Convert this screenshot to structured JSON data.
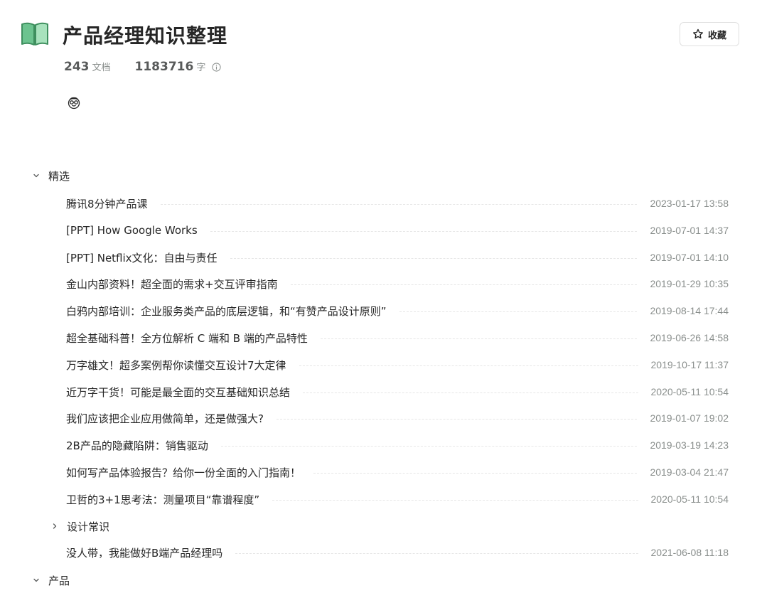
{
  "header": {
    "title": "产品经理知识整理",
    "favorite_label": "收藏",
    "doc_count": "243",
    "doc_unit": "文档",
    "word_count": "1183716",
    "word_unit": "字",
    "icons": {
      "book": "book-icon",
      "favorite": "star-icon",
      "info": "info-icon",
      "avatar": "nerd-face-emoji"
    }
  },
  "groups": [
    {
      "label": "精选",
      "expanded": true,
      "items": [
        {
          "title": "腾讯8分钟产品课",
          "time": "2023-01-17 13:58"
        },
        {
          "title": "[PPT] How Google Works",
          "time": "2019-07-01 14:37"
        },
        {
          "title": "[PPT] Netflix文化：自由与责任",
          "time": "2019-07-01 14:10"
        },
        {
          "title": "金山内部资料！超全面的需求+交互评审指南",
          "time": "2019-01-29 10:35"
        },
        {
          "title": "白鸦内部培训：企业服务类产品的底层逻辑，和“有赞产品设计原则”",
          "time": "2019-08-14 17:44"
        },
        {
          "title": "超全基础科普！全方位解析 C 端和 B 端的产品特性",
          "time": "2019-06-26 14:58"
        },
        {
          "title": "万字雄文！超多案例帮你读懂交互设计7大定律",
          "time": "2019-10-17 11:37"
        },
        {
          "title": "近万字干货！可能是最全面的交互基础知识总结",
          "time": "2020-05-11 10:54"
        },
        {
          "title": "我们应该把企业应用做简单，还是做强大?",
          "time": "2019-01-07 19:02"
        },
        {
          "title": "2B产品的隐藏陷阱：销售驱动",
          "time": "2019-03-19 14:23"
        },
        {
          "title": "如何写产品体验报告？给你一份全面的入门指南！",
          "time": "2019-03-04 21:47"
        },
        {
          "title": "卫哲的3+1思考法：测量项目“靠谱程度”",
          "time": "2020-05-11 10:54"
        }
      ],
      "subgroup": {
        "label": "设计常识",
        "expanded": false
      },
      "after_items": [
        {
          "title": "没人带，我能做好B端产品经理吗",
          "time": "2021-06-08 11:18"
        }
      ]
    },
    {
      "label": "产品",
      "expanded": true
    }
  ]
}
